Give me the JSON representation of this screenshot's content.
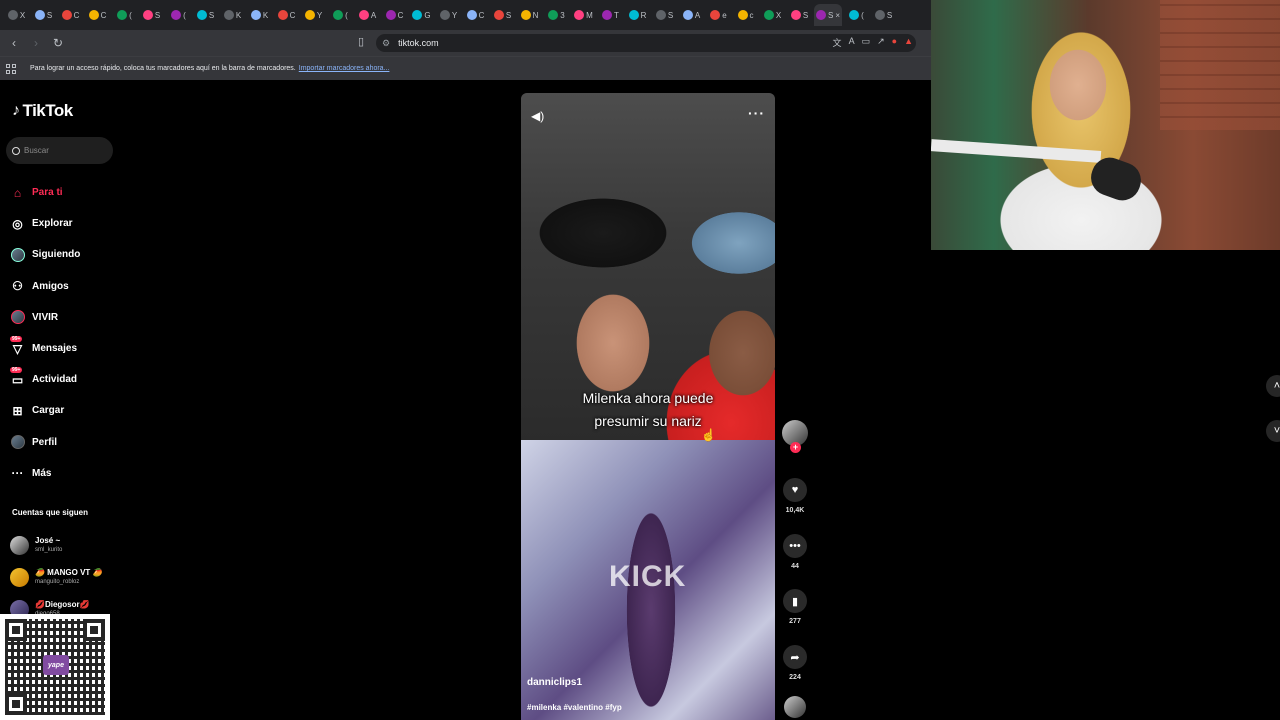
{
  "browser": {
    "tabs": [
      "X",
      "S",
      "C",
      "C",
      "(",
      "S",
      "(",
      "S",
      "K",
      "K",
      "C",
      "Y",
      "(",
      "A",
      "C",
      "G",
      "Y",
      "C",
      "S",
      "N",
      "3",
      "M",
      "T",
      "R",
      "S",
      "A",
      "e",
      "c",
      "X",
      "S",
      "S",
      "(",
      "S"
    ],
    "active_tab_close": "×",
    "url": "tiktok.com",
    "bookmarks_text": "Para lograr un acceso rápido, coloca tus marcadores aquí en la barra de marcadores.",
    "bookmarks_link": "Importar marcadores ahora..."
  },
  "sidebar": {
    "logo": "TikTok",
    "search_placeholder": "Buscar",
    "items": [
      {
        "label": "Para ti",
        "icon": "home-icon"
      },
      {
        "label": "Explorar",
        "icon": "compass-icon"
      },
      {
        "label": "Siguiendo",
        "icon": "following-avatar-icon"
      },
      {
        "label": "Amigos",
        "icon": "friends-icon"
      },
      {
        "label": "VIVIR",
        "icon": "live-icon"
      },
      {
        "label": "Mensajes",
        "icon": "messages-icon",
        "badge": "99+"
      },
      {
        "label": "Actividad",
        "icon": "activity-icon",
        "badge": "99+"
      },
      {
        "label": "Cargar",
        "icon": "upload-icon"
      },
      {
        "label": "Perfil",
        "icon": "profile-avatar-icon"
      },
      {
        "label": "Más",
        "icon": "more-icon"
      }
    ],
    "following_title": "Cuentas que siguen",
    "following": [
      {
        "name": "José ~",
        "username": "sml_kurito"
      },
      {
        "name": "🥭 MANGO VT 🥭",
        "username": "manguito_robloz"
      },
      {
        "name": "💋Diegosor💋",
        "username": "diego658"
      }
    ]
  },
  "video": {
    "caption_line1": "Milenka ahora puede",
    "caption_line2": "presumir su nariz",
    "overlay_text": "KICK",
    "author": "danniclips1",
    "hashtags": "#milenka #valentino #fyp"
  },
  "actions": {
    "likes": "10,4K",
    "comments": "44",
    "saves": "277",
    "shares": "224"
  },
  "qr": {
    "brand": "yape"
  },
  "colors": {
    "accent": "#fe2c55",
    "background": "#000000"
  }
}
